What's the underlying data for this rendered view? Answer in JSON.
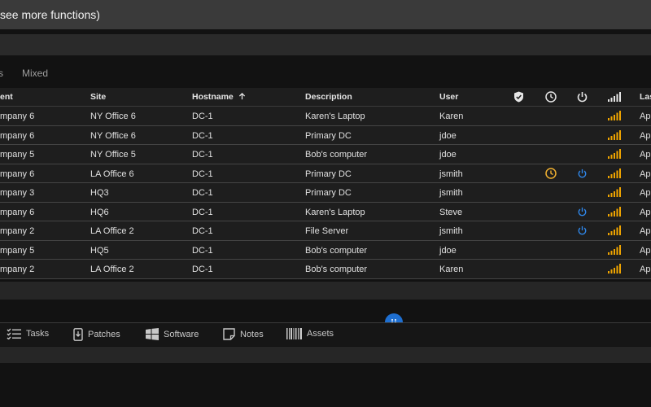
{
  "topbar": {
    "title": " see more functions)"
  },
  "filters": {
    "items": [
      "s",
      "Mixed"
    ]
  },
  "table": {
    "headers": {
      "client": "ent",
      "site": "Site",
      "hostname": "Hostname",
      "description": "Description",
      "user": "User",
      "last": "Las"
    },
    "sort_indicator": "arrow-up-icon",
    "header_icons": [
      "shield-check-icon",
      "clock-icon",
      "power-icon",
      "signal-icon"
    ],
    "rows": [
      {
        "client": "mpany 6",
        "site": "NY Office 6",
        "hostname": "DC-1",
        "description": "Karen's Laptop",
        "user": "Karen",
        "pending": false,
        "reboot": false,
        "last": "Ap"
      },
      {
        "client": "mpany 6",
        "site": "NY Office 6",
        "hostname": "DC-1",
        "description": "Primary DC",
        "user": "jdoe",
        "pending": false,
        "reboot": false,
        "last": "Ap"
      },
      {
        "client": "mpany 5",
        "site": "NY Office 5",
        "hostname": "DC-1",
        "description": "Bob's computer",
        "user": "jdoe",
        "pending": false,
        "reboot": false,
        "last": "Ap"
      },
      {
        "client": "mpany 6",
        "site": "LA Office 6",
        "hostname": "DC-1",
        "description": "Primary DC",
        "user": "jsmith",
        "pending": true,
        "reboot": true,
        "last": "Ap"
      },
      {
        "client": "mpany 3",
        "site": "HQ3",
        "hostname": "DC-1",
        "description": "Primary DC",
        "user": "jsmith",
        "pending": false,
        "reboot": false,
        "last": "Ap"
      },
      {
        "client": "mpany 6",
        "site": "HQ6",
        "hostname": "DC-1",
        "description": "Karen's Laptop",
        "user": "Steve",
        "pending": false,
        "reboot": true,
        "last": "Ap"
      },
      {
        "client": "mpany 2",
        "site": "LA Office 2",
        "hostname": "DC-1",
        "description": "File Server",
        "user": "jsmith",
        "pending": false,
        "reboot": true,
        "last": "Ap"
      },
      {
        "client": "mpany 5",
        "site": "HQ5",
        "hostname": "DC-1",
        "description": "Bob's computer",
        "user": "jdoe",
        "pending": false,
        "reboot": false,
        "last": "Ap"
      },
      {
        "client": "mpany 2",
        "site": "LA Office 2",
        "hostname": "DC-1",
        "description": "Bob's computer",
        "user": "Karen",
        "pending": false,
        "reboot": false,
        "last": "Ap"
      }
    ]
  },
  "bottom_tabs": [
    {
      "label": "Tasks",
      "icon": "checklist-icon"
    },
    {
      "label": "Patches",
      "icon": "phone-download-icon"
    },
    {
      "label": "Software",
      "icon": "windows-icon"
    },
    {
      "label": "Notes",
      "icon": "note-icon"
    },
    {
      "label": "Assets",
      "icon": "barcode-icon"
    }
  ],
  "colors": {
    "accent": "#1e6fd1",
    "signal": "#f0a500",
    "pending": "#f0b030",
    "reboot": "#2f86e8"
  }
}
